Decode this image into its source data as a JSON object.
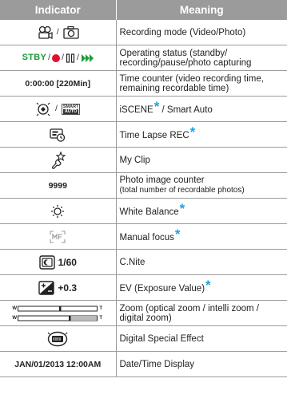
{
  "header": {
    "indicator": "Indicator",
    "meaning": "Meaning"
  },
  "colors": {
    "header_bg": "#9b9b9b",
    "star": "#1aa3e0",
    "standby_green": "#1a9b3a",
    "record_red": "#e0102f",
    "capture_green": "#1a9b3a"
  },
  "rows": [
    {
      "icons": [
        "video-mode-icon",
        "photo-mode-icon"
      ],
      "meaning": "Recording mode (Video/Photo)"
    },
    {
      "status_text": "STBY",
      "icons": [
        "record-dot-icon",
        "pause-icon",
        "photo-capture-icon"
      ],
      "meaning": "Operating status (standby/ recording/pause/photo capturing"
    },
    {
      "indicator_text": "0:00:00 [220Min]",
      "meaning": "Time counter (video recording time, remaining recordable time)"
    },
    {
      "icons": [
        "iscene-icon",
        "smart-auto-icon"
      ],
      "smart_label": "SMART",
      "auto_label": "AUTO",
      "meaning": "iSCENE",
      "meaning_suffix": "/ Smart Auto",
      "star": "*"
    },
    {
      "icons": [
        "time-lapse-icon"
      ],
      "meaning": "Time Lapse REC",
      "star": "*"
    },
    {
      "icons": [
        "my-clip-icon"
      ],
      "meaning": "My Clip"
    },
    {
      "indicator_text": "9999",
      "meaning": "Photo image counter",
      "meaning_sub": "(total number of recordable photos)"
    },
    {
      "icons": [
        "white-balance-icon"
      ],
      "meaning": "White Balance",
      "star": "*"
    },
    {
      "icons": [
        "manual-focus-icon"
      ],
      "meaning": "Manual focus",
      "star": "*"
    },
    {
      "icons": [
        "c-nite-icon"
      ],
      "indicator_text": "1/60",
      "meaning": "C.Nite"
    },
    {
      "icons": [
        "ev-icon"
      ],
      "indicator_text": "+0.3",
      "meaning": "EV (Exposure Value)",
      "star": "*"
    },
    {
      "icons": [
        "zoom-bar-icon"
      ],
      "zoom_w": "W",
      "zoom_t": "T",
      "meaning": "Zoom (optical zoom / intelli zoom / digital zoom)"
    },
    {
      "icons": [
        "digital-effect-icon"
      ],
      "meaning": "Digital Special Effect"
    },
    {
      "indicator_text": "JAN/01/2013 12:00AM",
      "meaning": "Date/Time Display"
    }
  ]
}
